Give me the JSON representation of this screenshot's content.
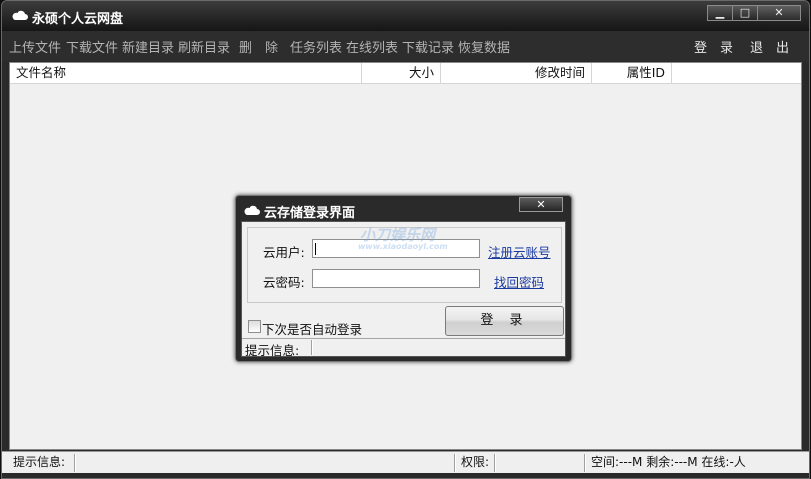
{
  "window": {
    "title": "永硕个人云网盘",
    "controls": {
      "minimize": "▁",
      "maximize": "□",
      "close": "✕"
    },
    "icon": "cloud-icon"
  },
  "toolbar": {
    "items": [
      "上传文件",
      "下载文件",
      "新建目录",
      "刷新目录",
      "删　除",
      "任务列表",
      "在线列表",
      "下载记录",
      "恢复数据"
    ],
    "login": "登　录",
    "logout": "退　出"
  },
  "file_list": {
    "columns": [
      "文件名称",
      "大小",
      "修改时间",
      "属性ID"
    ]
  },
  "statusbar": {
    "hint": "提示信息:",
    "permission": "权限:",
    "space": "空间:---M 剩余:---M 在线:-人"
  },
  "dialog": {
    "title": "云存储登录界面",
    "close": "✕",
    "user_label": "云用户:",
    "user_value": "",
    "password_label": "云密码:",
    "password_value": "",
    "register_link": "注册云账号",
    "recover_link": "找回密码",
    "auto_login_label": "下次是否自动登录",
    "auto_login_checked": false,
    "login_button": "登 录",
    "hint_label": "提示信息:",
    "watermark_main": "小刀娱乐网",
    "watermark_sub": "www.xiaodaoyl.com"
  },
  "colors": {
    "frame": "#2a2a2a",
    "client": "#f0f0f0",
    "toolbar_text": "#b4b4b4",
    "link": "#1a3aa0"
  }
}
